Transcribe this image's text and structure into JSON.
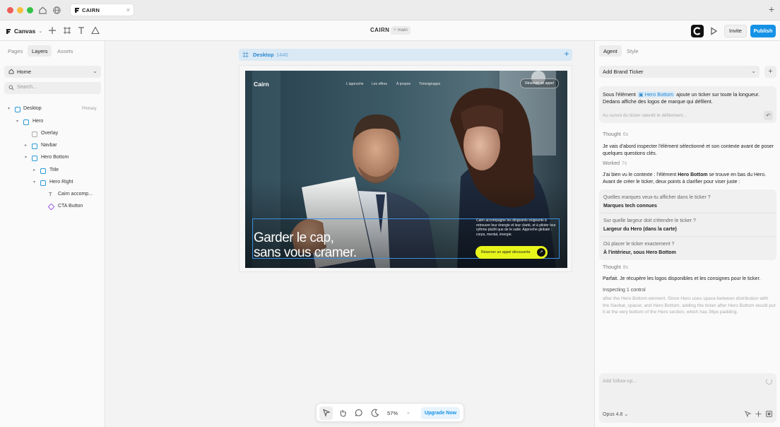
{
  "window": {
    "tab_title": "CAIRN",
    "tab_close": "×",
    "new_tab": "+",
    "traffic_lights": {
      "close": "#ee5e57",
      "minimize": "#f5be3d",
      "maximize": "#34c246"
    }
  },
  "toolbar": {
    "canvas_label": "Canvas",
    "doc_title": "CAIRN",
    "branch": "main",
    "invite_label": "Invite",
    "publish_label": "Publish",
    "accent": "#1592e6"
  },
  "left_panel": {
    "tabs": [
      "Pages",
      "Layers",
      "Assets"
    ],
    "page_select": "Home",
    "search_placeholder": "Search...",
    "layers": [
      {
        "name": "Desktop",
        "tag": "Primary",
        "icon": "frame-icon"
      },
      {
        "name": "Hero",
        "icon": "frame-icon"
      },
      {
        "name": "Overlay",
        "icon": "rectangle-icon"
      },
      {
        "name": "Navbar",
        "icon": "frame-icon"
      },
      {
        "name": "Hero Bottom",
        "icon": "frame-icon"
      },
      {
        "name": "Title",
        "icon": "frame-icon"
      },
      {
        "name": "Hero Right",
        "icon": "frame-icon"
      },
      {
        "name": "Cairn accomp...",
        "icon": "text-icon"
      },
      {
        "name": "CTA Button",
        "icon": "component-icon"
      }
    ]
  },
  "canvas": {
    "frame_name": "Desktop",
    "frame_width": "1440",
    "hero": {
      "brand": "Cairn",
      "nav": [
        "L'approche",
        "Les offres",
        "À propos",
        "Témoignages"
      ],
      "cta_top": "Réserver un appel",
      "headline_1": "Garder le cap,",
      "headline_2": "sans vous cramer.",
      "paragraph": "Cairn accompagne les dirigeants exigeants à retrouver leur énergie et leur clarté, et à piloter leur rythme plutôt que de le subir. Approche globale : corps, mental, énergie.",
      "cta": "Réserver un appel découverte",
      "cta_color": "#e8f51a"
    },
    "zoom": "57%",
    "upgrade_label": "Upgrade Now"
  },
  "right_panel": {
    "tabs": [
      "Agent",
      "Style"
    ],
    "task_select": "Add Brand Ticker",
    "user_message": {
      "before": "Sous l'élément",
      "chip": "Hero Bottom",
      "after": "ajoute un ticker sur toute la longueur. Dedans affiche des logos de marque qui défilent.",
      "sub": "Au survol du ticker ralentit le défilement..."
    },
    "thought1": {
      "label": "Thought",
      "dur": "6s"
    },
    "thought1_text": "Je vais d'abord inspecter l'élément sélectionné et son contexte avant de poser quelques questions clés.",
    "worked": {
      "label": "Worked",
      "dur": "7s"
    },
    "worked_text_1": "J'ai bien vu le contexte : l'élément",
    "worked_bold_1": "Hero Bottom",
    "worked_text_2": "se trouve en bas du Hero. Avant de créer le ticker, deux points à clarifier pour viser juste :",
    "questions": [
      {
        "q": "Quelles marques veux-tu afficher dans le ticker ?",
        "a": "Marques tech connues"
      },
      {
        "q": "Sur quelle largeur doit s'étendre le ticker ?",
        "a": "Largeur du Hero (dans la carte)"
      },
      {
        "q": "Où placer le ticker exactement ?",
        "a": "À l'intérieur, sous Hero Bottom"
      }
    ],
    "thought2": {
      "label": "Thought",
      "dur": "8s"
    },
    "thought2_text": "Parfait. Je récupère les logos disponibles et les consignes pour le ticker.",
    "inspecting": "Inspecting 1 control",
    "faint_text": "after the Hero Bottom element. Since Hero uses space-between distribution with the Navbar, spacer, and Hero Bottom, adding the ticker after Hero Bottom would put it at the very bottom of the Hero section, which has 36px padding.",
    "compose_placeholder": "Add follow-up...",
    "model": "Opus 4.8"
  }
}
